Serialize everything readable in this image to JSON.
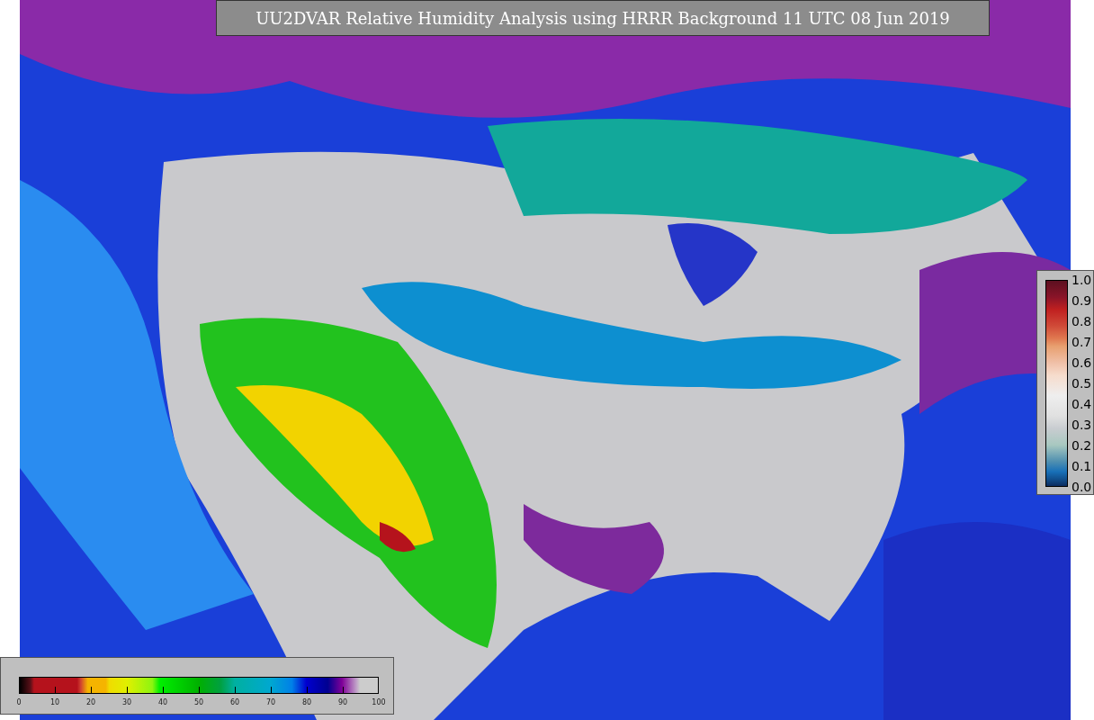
{
  "title": "UU2DVAR Relative Humidity Analysis using HRRR Background 11 UTC 08 Jun 2019",
  "humidity_colorbar": {
    "ticks": [
      "0",
      "10",
      "20",
      "30",
      "40",
      "50",
      "60",
      "70",
      "80",
      "90",
      "100"
    ]
  },
  "observation_colorbar": {
    "ticks": [
      "1.0",
      "0.9",
      "0.8",
      "0.7",
      "0.6",
      "0.5",
      "0.4",
      "0.3",
      "0.2",
      "0.1",
      "0.0"
    ]
  }
}
